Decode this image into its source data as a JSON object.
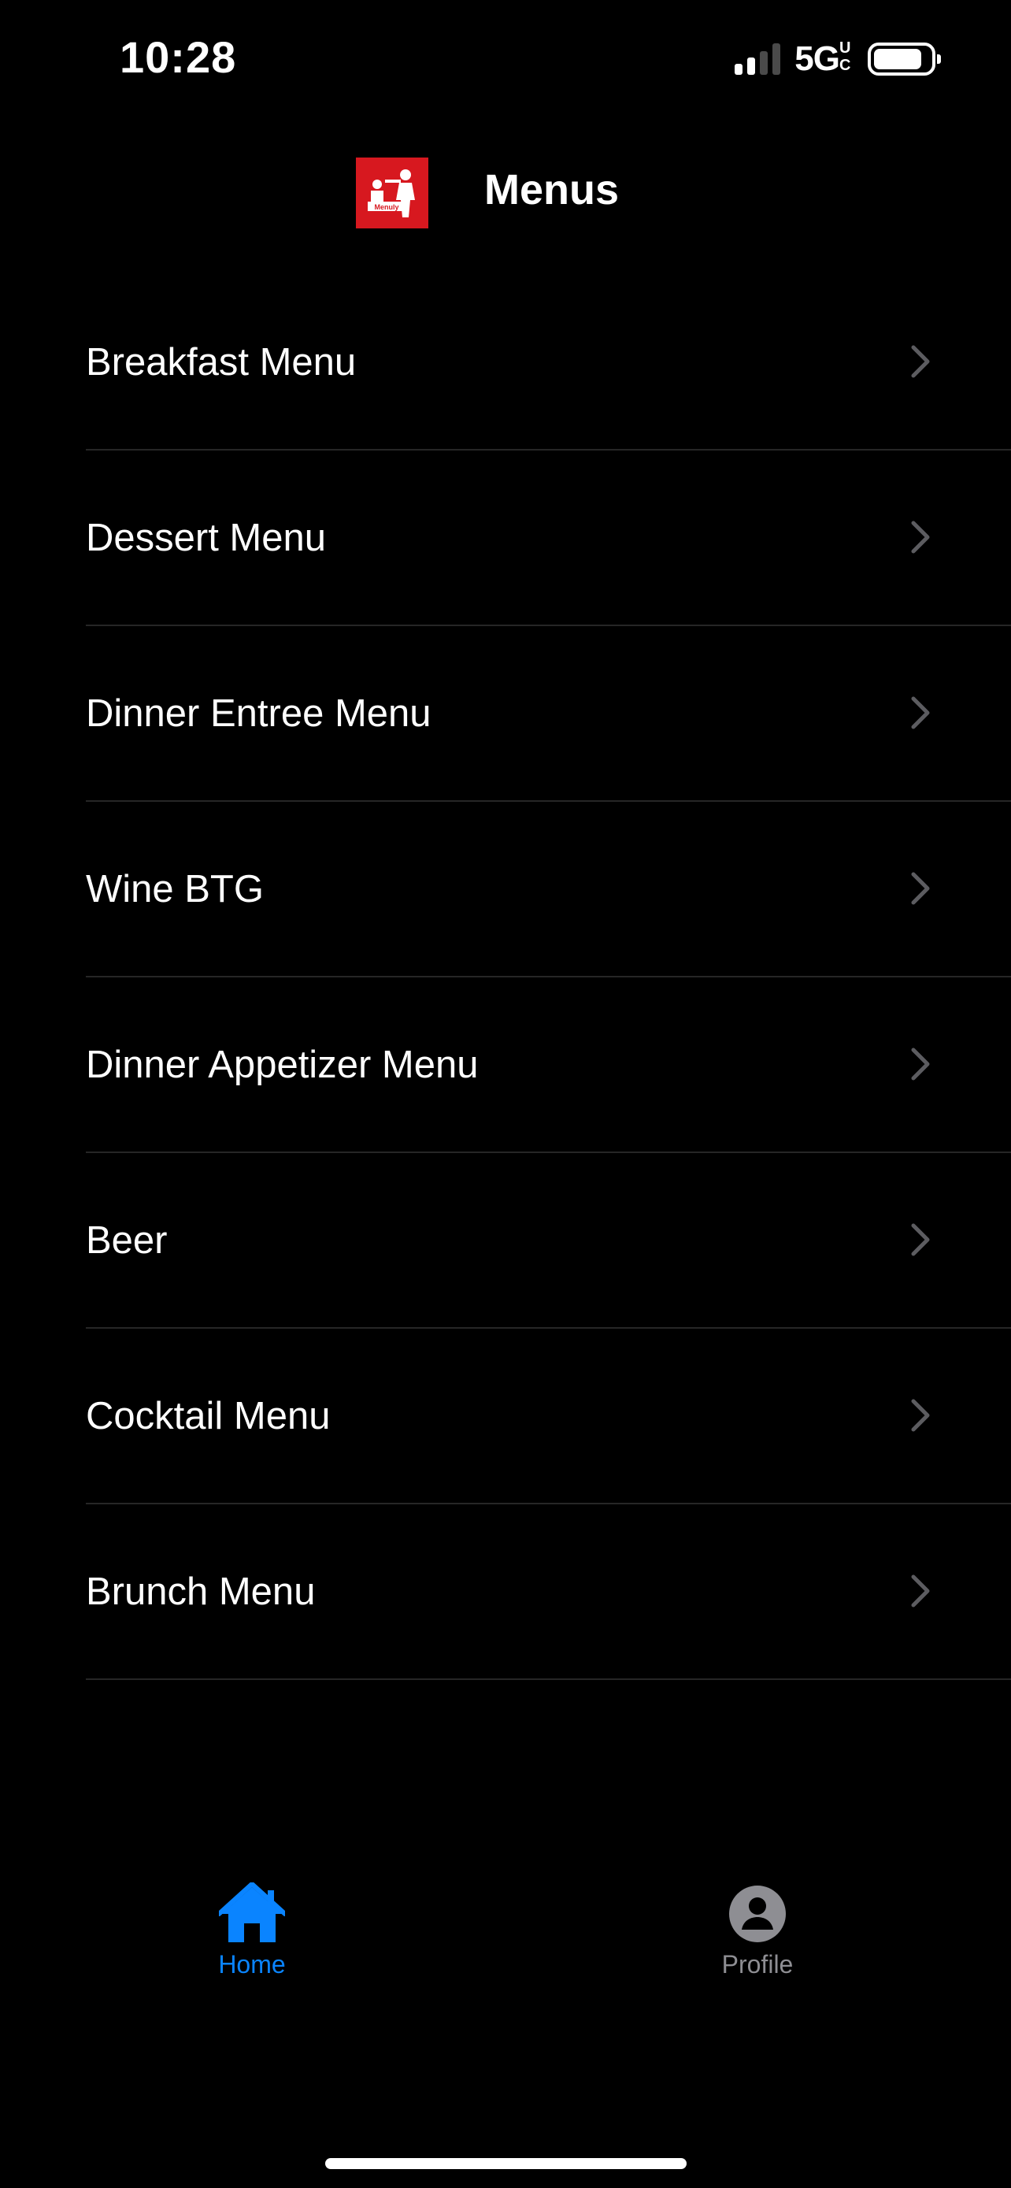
{
  "status_bar": {
    "time": "10:28",
    "network": "5G",
    "network_suffix": "UC",
    "battery_level": 0.85,
    "signal_bars": 4,
    "signal_active_bars": 2
  },
  "header": {
    "logo_text": "Menuly",
    "title": "Menus"
  },
  "menus": [
    {
      "label": "Breakfast Menu"
    },
    {
      "label": "Dessert Menu"
    },
    {
      "label": "Dinner Entree Menu"
    },
    {
      "label": "Wine BTG"
    },
    {
      "label": "Dinner Appetizer Menu"
    },
    {
      "label": "Beer"
    },
    {
      "label": "Cocktail Menu"
    },
    {
      "label": "Brunch Menu"
    }
  ],
  "tab_bar": {
    "home_label": "Home",
    "profile_label": "Profile",
    "active_tab": "Home"
  },
  "colors": {
    "background": "#000000",
    "accent": "#0a84ff",
    "inactive": "#8e8e93",
    "brand": "#d7181f",
    "chevron": "#5c5c60"
  },
  "icons": {
    "row_icon": "chevron-right-icon",
    "home_icon": "house-icon",
    "profile_icon": "person-circle-icon"
  }
}
